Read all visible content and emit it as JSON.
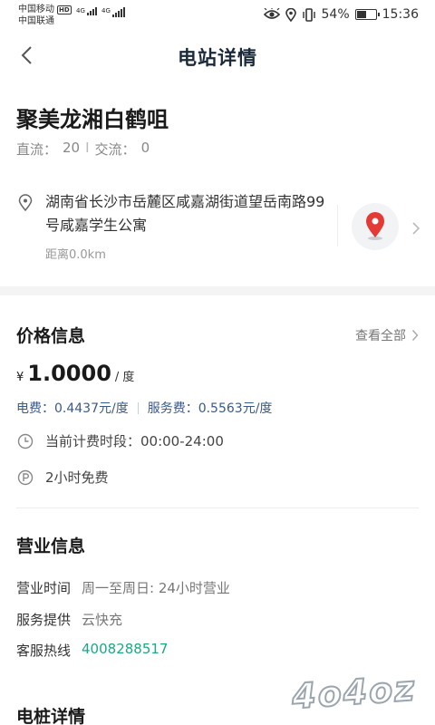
{
  "status_bar": {
    "carrier1": "中国移动",
    "carrier2": "中国联通",
    "hd": "HD",
    "net1": "4G",
    "net2": "4G",
    "battery": "54%",
    "battery_level": 0.54,
    "time": "15:36"
  },
  "nav": {
    "title": "电站详情"
  },
  "station": {
    "name": "聚美龙湘白鹤咀",
    "dc_label": "直流：",
    "dc_count": "20",
    "ac_label": "交流：",
    "ac_count": "0",
    "address": "湖南省长沙市岳麓区咸嘉湖街道望岳南路99号咸嘉学生公寓",
    "distance": "距离0.0km"
  },
  "price": {
    "title": "价格信息",
    "view_all": "查看全部",
    "currency": "¥",
    "amount": "1.0000",
    "unit": "/ 度",
    "electricity_fee": "电费：0.4437元/度",
    "service_fee": "服务费：0.5563元/度",
    "period": "当前计费时段：00:00-24:00",
    "parking": "2小时免费"
  },
  "business": {
    "title": "营业信息",
    "hours_label": "营业时间",
    "hours_value": "周一至周日: 24小时营业",
    "provider_label": "服务提供",
    "provider_value": "云快充",
    "hotline_label": "客服热线",
    "hotline_value": "4008288517"
  },
  "piles": {
    "title": "电桩详情"
  },
  "watermark": "4o4oz",
  "colors": {
    "accent_green": "#1aa886",
    "fee_blue": "#3a5a8a",
    "map_pin_red": "#e53935"
  }
}
